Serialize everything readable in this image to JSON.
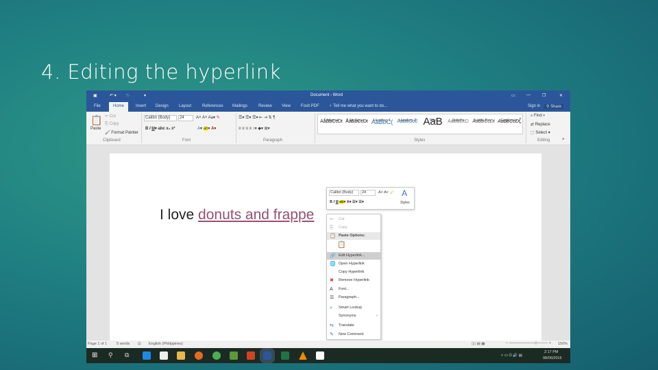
{
  "slide": {
    "title": "4. Editing the hyperlink"
  },
  "window": {
    "title": "Document - Word",
    "sign_in": "Sign in",
    "share": "Share",
    "tell_me": "Tell me what you want to do..."
  },
  "tabs": [
    "File",
    "Home",
    "Insert",
    "Design",
    "Layout",
    "References",
    "Mailings",
    "Review",
    "View",
    "Foxit PDF"
  ],
  "ribbon": {
    "clipboard": {
      "paste": "Paste",
      "cut": "Cut",
      "copy": "Copy",
      "format_painter": "Format Painter",
      "label": "Clipboard"
    },
    "font": {
      "name": "Calibri (Body)",
      "size": "24",
      "label": "Font"
    },
    "paragraph": {
      "label": "Paragraph"
    },
    "styles": {
      "label": "Styles",
      "items": [
        {
          "preview": "AaBbCcDt",
          "name": "¶ Normal"
        },
        {
          "preview": "AaBbCcDt",
          "name": "¶ No Spac..."
        },
        {
          "preview": "AaBbC(",
          "name": "Heading 1"
        },
        {
          "preview": "AaBbCcE",
          "name": "Heading 2"
        },
        {
          "preview": "AaB",
          "name": "Title"
        },
        {
          "preview": "AaBbCcD",
          "name": "Subtitle"
        },
        {
          "preview": "AaBbCcDt",
          "name": "Subtle Em..."
        },
        {
          "preview": "AaBbCcDt",
          "name": "Emphasis"
        }
      ]
    },
    "editing": {
      "find": "Find",
      "replace": "Replace",
      "select": "Select",
      "label": "Editing"
    }
  },
  "document": {
    "text_plain": "I love ",
    "text_link": "donuts and frappe"
  },
  "mini_toolbar": {
    "font": "Calibri (Body)",
    "size": "24",
    "styles": "Styles"
  },
  "context_menu": [
    "Cut",
    "Copy",
    "Paste Options:",
    "Edit Hyperlink...",
    "Open Hyperlink",
    "Copy Hyperlink",
    "Remove Hyperlink",
    "Font...",
    "Paragraph...",
    "Smart Lookup",
    "Synonyms",
    "Translate",
    "New Comment"
  ],
  "status": {
    "page": "Page 1 of 1",
    "words": "5 words",
    "language": "English (Philippines)",
    "zoom": "150%"
  },
  "taskbar": {
    "time": "2:17 PM",
    "date": "08/06/2016"
  },
  "colors": {
    "word_blue": "#2b579a",
    "link": "#954f72"
  }
}
